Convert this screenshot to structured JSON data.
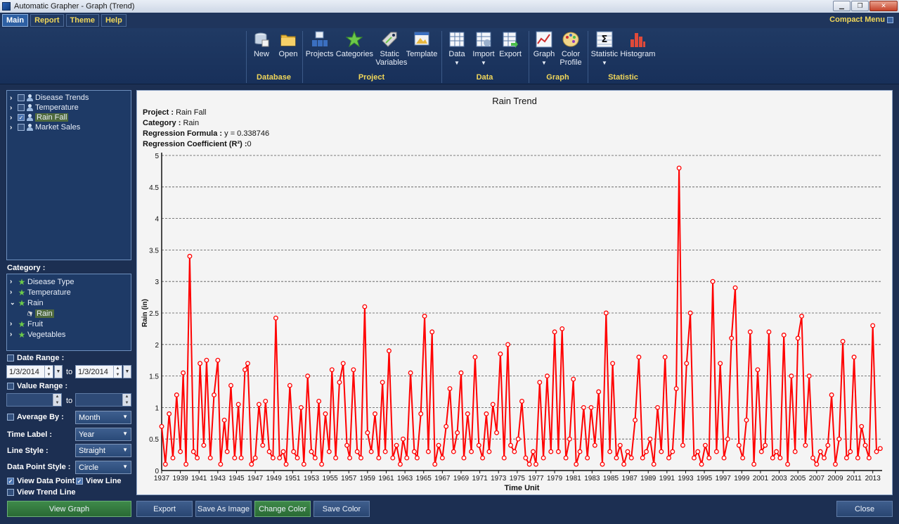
{
  "window": {
    "title": "Automatic Grapher - Graph (Trend)",
    "min": "▁",
    "max": "❐",
    "close": "✕"
  },
  "menu": {
    "tabs": [
      "Main",
      "Report",
      "Theme",
      "Help"
    ],
    "compact": "Compact Menu"
  },
  "ribbon": {
    "groups": [
      {
        "label": "Database",
        "items": [
          {
            "label": "New"
          },
          {
            "label": "Open"
          }
        ]
      },
      {
        "label": "Project",
        "items": [
          {
            "label": "Projects"
          },
          {
            "label": "Categories"
          },
          {
            "label": "Static Variables"
          },
          {
            "label": "Template"
          }
        ]
      },
      {
        "label": "Data",
        "items": [
          {
            "label": "Data"
          },
          {
            "label": "Import"
          },
          {
            "label": "Export"
          }
        ]
      },
      {
        "label": "Graph",
        "items": [
          {
            "label": "Graph"
          },
          {
            "label": "Color Profile"
          }
        ]
      },
      {
        "label": "Statistic",
        "items": [
          {
            "label": "Statistic"
          },
          {
            "label": "Histogram"
          }
        ]
      }
    ]
  },
  "projects_tree": [
    {
      "label": "Disease Trends",
      "checked": false
    },
    {
      "label": "Temperature",
      "checked": false
    },
    {
      "label": "Rain Fall",
      "checked": true
    },
    {
      "label": "Market Sales",
      "checked": false
    }
  ],
  "category": {
    "heading": "Category :",
    "items": [
      "Disease Type",
      "Temperature",
      "Rain",
      "Rain",
      "Fruit",
      "Vegetables"
    ]
  },
  "options": {
    "date_range": "Date Range :",
    "date_from": "1/3/2014",
    "date_to": "1/3/2014",
    "to": "to",
    "value_range": "Value Range :",
    "average_by": "Average By :",
    "average_value": "Month",
    "time_label": "Time Label :",
    "time_value": "Year",
    "line_style": "Line Style :",
    "line_value": "Straight",
    "point_style": "Data Point Style :",
    "point_value": "Circle",
    "view_points": "View Data Point",
    "view_line": "View Line",
    "view_trend": "View Trend Line"
  },
  "buttons": {
    "view_graph": "View Graph",
    "export": "Export",
    "save_image": "Save As Image",
    "change_color": "Change Color",
    "save_color": "Save Color",
    "close": "Close"
  },
  "info": {
    "project_label": "Project :",
    "project": "Rain Fall",
    "category_label": "Category :",
    "category": "Rain",
    "formula_label": "Regression Formula :",
    "formula": "y = 0.338746",
    "coef_label": "Regression Coefficient (R²) :",
    "coef": "0"
  },
  "colors": {
    "series": "#ff0000",
    "accent": "#f1d75a"
  },
  "chart_data": {
    "type": "line",
    "title": "Rain Trend",
    "xlabel": "Time Unit",
    "ylabel": "Rain (in)",
    "ylim": [
      0,
      5
    ],
    "xlim": [
      1937,
      2014
    ],
    "yticks": [
      0,
      0.5,
      1,
      1.5,
      2,
      2.5,
      3,
      3.5,
      4,
      4.5,
      5
    ],
    "xticks": [
      "1937",
      "1939",
      "1941",
      "1943",
      "1945",
      "1947",
      "1949",
      "1951",
      "1953",
      "1955",
      "1957",
      "1959",
      "1961",
      "1963",
      "1965",
      "1967",
      "1969",
      "1971",
      "1973",
      "1975",
      "1977",
      "1979",
      "1981",
      "1983",
      "1985",
      "1987",
      "1989",
      "1991",
      "1993",
      "1995",
      "1997",
      "1999",
      "2001",
      "2003",
      "2005",
      "2007",
      "2009",
      "2011",
      "2013"
    ],
    "grid": true,
    "series": [
      {
        "color": "#ff0000",
        "x": [
          1937.0,
          1937.4,
          1937.8,
          1938.2,
          1938.6,
          1939.0,
          1939.3,
          1939.6,
          1940.0,
          1940.4,
          1940.8,
          1941.1,
          1941.5,
          1941.8,
          1942.2,
          1942.6,
          1943.0,
          1943.3,
          1943.7,
          1944.0,
          1944.4,
          1944.8,
          1945.2,
          1945.5,
          1945.9,
          1946.2,
          1946.6,
          1947.0,
          1947.4,
          1947.8,
          1948.1,
          1948.5,
          1948.9,
          1949.2,
          1949.6,
          1950.0,
          1950.3,
          1950.7,
          1951.1,
          1951.5,
          1951.9,
          1952.2,
          1952.6,
          1953.0,
          1953.4,
          1953.8,
          1954.1,
          1954.5,
          1954.9,
          1955.2,
          1955.6,
          1956.0,
          1956.4,
          1956.8,
          1957.1,
          1957.5,
          1957.9,
          1958.3,
          1958.7,
          1959.0,
          1959.4,
          1959.8,
          1960.2,
          1960.6,
          1960.9,
          1961.3,
          1961.7,
          1962.1,
          1962.5,
          1962.8,
          1963.2,
          1963.6,
          1964.0,
          1964.3,
          1964.7,
          1965.1,
          1965.5,
          1965.9,
          1966.2,
          1966.6,
          1967.0,
          1967.4,
          1967.8,
          1968.2,
          1968.6,
          1969.0,
          1969.3,
          1969.7,
          1970.1,
          1970.5,
          1970.9,
          1971.3,
          1971.7,
          1972.0,
          1972.4,
          1972.8,
          1973.2,
          1973.6,
          1974.0,
          1974.3,
          1974.7,
          1975.1,
          1975.5,
          1975.9,
          1976.3,
          1976.7,
          1977.0,
          1977.4,
          1977.8,
          1978.2,
          1978.6,
          1979.0,
          1979.4,
          1979.8,
          1980.2,
          1980.6,
          1981.0,
          1981.3,
          1981.7,
          1982.1,
          1982.5,
          1982.9,
          1983.3,
          1983.7,
          1984.1,
          1984.5,
          1984.9,
          1985.2,
          1985.6,
          1986.0,
          1986.4,
          1986.8,
          1987.2,
          1987.6,
          1988.0,
          1988.4,
          1988.8,
          1989.2,
          1989.6,
          1990.0,
          1990.4,
          1990.8,
          1991.2,
          1991.6,
          1992.0,
          1992.3,
          1992.7,
          1993.1,
          1993.5,
          1993.9,
          1994.3,
          1994.7,
          1995.1,
          1995.5,
          1995.9,
          1996.3,
          1996.7,
          1997.1,
          1997.5,
          1997.9,
          1998.3,
          1998.7,
          1999.1,
          1999.5,
          1999.9,
          2000.3,
          2000.7,
          2001.1,
          2001.5,
          2001.9,
          2002.3,
          2002.7,
          2003.1,
          2003.5,
          2003.9,
          2004.3,
          2004.7,
          2005.0,
          2005.4,
          2005.8,
          2006.2,
          2006.6,
          2007.0,
          2007.4,
          2007.8,
          2008.2,
          2008.6,
          2009.0,
          2009.4,
          2009.8,
          2010.2,
          2010.6,
          2011.0,
          2011.4,
          2011.8,
          2012.2,
          2012.6,
          2013.0,
          2013.4,
          2013.8
        ],
        "y": [
          0.7,
          0.1,
          0.9,
          0.2,
          1.2,
          0.3,
          1.55,
          0.1,
          3.4,
          0.3,
          0.2,
          1.7,
          0.4,
          1.75,
          0.2,
          1.2,
          1.75,
          0.1,
          0.8,
          0.3,
          1.35,
          0.2,
          1.05,
          0.2,
          1.6,
          1.7,
          0.1,
          0.2,
          1.05,
          0.4,
          1.1,
          0.3,
          0.2,
          2.42,
          0.2,
          0.3,
          0.1,
          1.35,
          0.3,
          0.2,
          1.0,
          0.1,
          1.5,
          0.3,
          0.2,
          1.1,
          0.1,
          0.9,
          0.3,
          1.6,
          0.2,
          1.4,
          1.7,
          0.4,
          0.2,
          1.6,
          0.3,
          0.2,
          2.6,
          0.6,
          0.3,
          0.9,
          0.2,
          1.4,
          0.3,
          1.9,
          0.2,
          0.4,
          0.1,
          0.5,
          0.2,
          1.55,
          0.3,
          0.2,
          0.9,
          2.45,
          0.3,
          2.2,
          0.1,
          0.4,
          0.2,
          0.7,
          1.3,
          0.3,
          0.6,
          1.55,
          0.2,
          0.9,
          0.3,
          1.8,
          0.4,
          0.2,
          0.9,
          0.3,
          1.05,
          0.6,
          1.85,
          0.2,
          2.0,
          0.4,
          0.3,
          0.5,
          1.1,
          0.2,
          0.1,
          0.3,
          0.1,
          1.4,
          0.2,
          1.5,
          0.3,
          2.2,
          0.3,
          2.25,
          0.2,
          0.5,
          1.45,
          0.1,
          0.3,
          1.0,
          0.2,
          1.0,
          0.4,
          1.25,
          0.1,
          2.5,
          0.3,
          1.7,
          0.2,
          0.4,
          0.1,
          0.3,
          0.2,
          0.8,
          1.8,
          0.2,
          0.3,
          0.5,
          0.1,
          1.0,
          0.3,
          1.8,
          0.2,
          0.3,
          1.3,
          4.8,
          0.4,
          1.7,
          2.5,
          0.2,
          0.3,
          0.1,
          0.4,
          0.2,
          3.0,
          0.3,
          1.7,
          0.2,
          0.5,
          2.1,
          2.9,
          0.4,
          0.2,
          0.8,
          2.2,
          0.1,
          1.6,
          0.3,
          0.4,
          2.2,
          0.2,
          0.3,
          0.2,
          2.15,
          0.1,
          1.5,
          0.3,
          2.1,
          2.45,
          0.4,
          1.5,
          0.2,
          0.1,
          0.3,
          0.2,
          0.4,
          1.2,
          0.1,
          0.5,
          2.05,
          0.2,
          0.3,
          1.8,
          0.2,
          0.7,
          0.4,
          0.2,
          2.3,
          0.3,
          0.35
        ]
      }
    ]
  }
}
